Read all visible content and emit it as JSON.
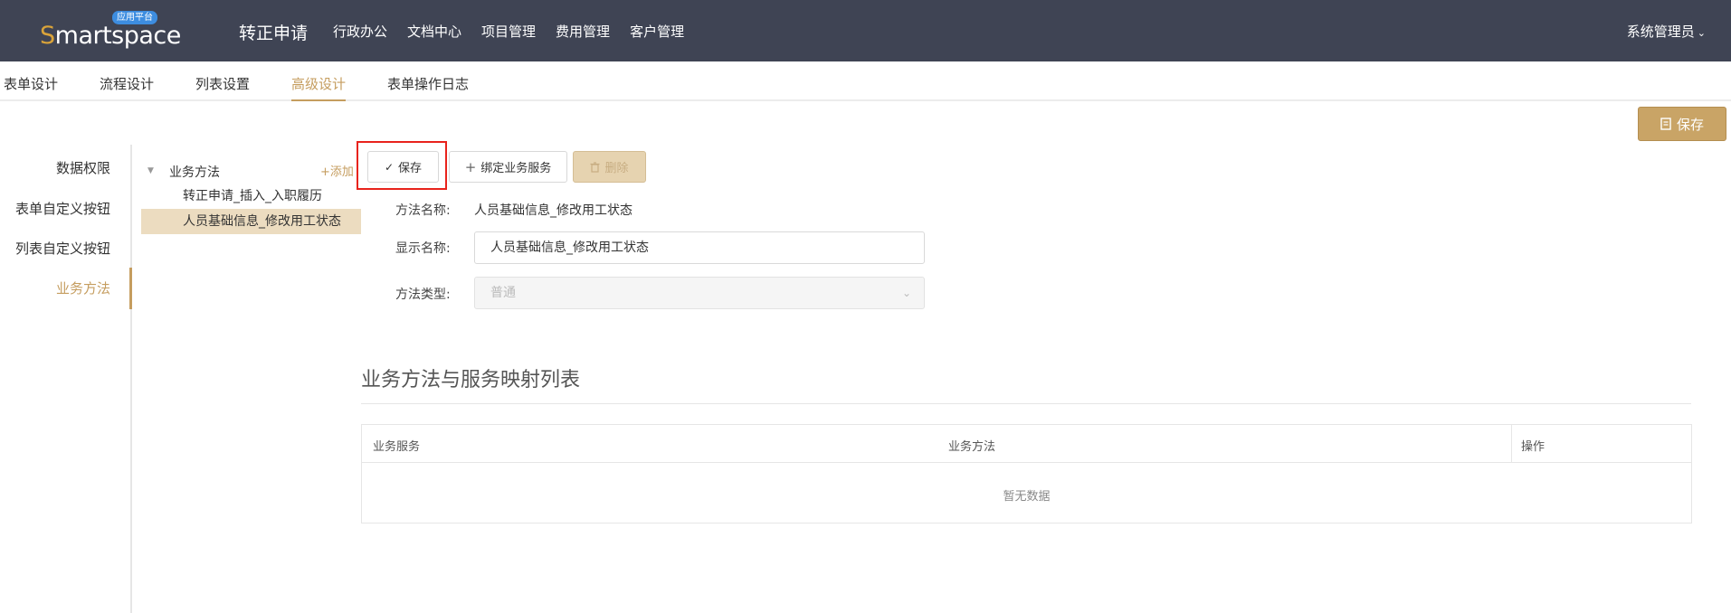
{
  "header": {
    "logo_badge": "应用平台",
    "logo_s": "S",
    "logo_rest": "martspace",
    "app_title": "转正申请",
    "nav": [
      "行政办公",
      "文档中心",
      "项目管理",
      "费用管理",
      "客户管理"
    ],
    "user": "系统管理员"
  },
  "tabs": [
    {
      "label": "表单设计",
      "active": false
    },
    {
      "label": "流程设计",
      "active": false
    },
    {
      "label": "列表设置",
      "active": false
    },
    {
      "label": "高级设计",
      "active": true
    },
    {
      "label": "表单操作日志",
      "active": false
    }
  ],
  "top_save": "保存",
  "left_menu": [
    {
      "label": "数据权限",
      "active": false
    },
    {
      "label": "表单自定义按钮",
      "active": false
    },
    {
      "label": "列表自定义按钮",
      "active": false
    },
    {
      "label": "业务方法",
      "active": true
    }
  ],
  "tree": {
    "root": "业务方法",
    "add": "+添加",
    "items": [
      {
        "label": "转正申请_插入_入职履历",
        "selected": false
      },
      {
        "label": "人员基础信息_修改用工状态",
        "selected": true
      }
    ]
  },
  "toolbar": {
    "save": "保存",
    "bind": "绑定业务服务",
    "delete": "删除"
  },
  "form": {
    "method_name_label": "方法名称:",
    "method_name_value": "人员基础信息_修改用工状态",
    "display_name_label": "显示名称:",
    "display_name_value": "人员基础信息_修改用工状态",
    "method_type_label": "方法类型:",
    "method_type_value": "普通"
  },
  "section": {
    "title": "业务方法与服务映射列表",
    "columns": [
      "业务服务",
      "业务方法",
      "操作"
    ],
    "empty": "暂无数据"
  }
}
